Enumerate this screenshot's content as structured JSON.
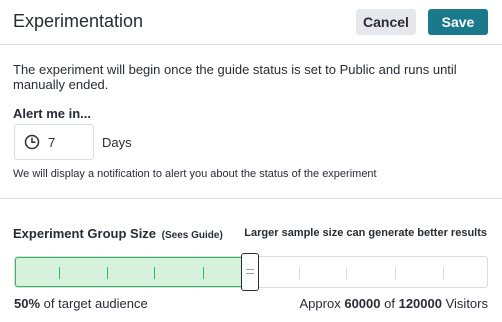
{
  "header": {
    "title": "Experimentation",
    "cancel_label": "Cancel",
    "save_label": "Save"
  },
  "intro_text": "The experiment will begin once the guide status is set to Public and runs until manually ended.",
  "alert": {
    "label": "Alert me in...",
    "value": "7",
    "unit": "Days",
    "notice": "We will display a notification to alert you about the status of the experiment"
  },
  "group_size": {
    "label": "Experiment Group Size",
    "sublabel": "(Sees Guide)",
    "hint": "Larger sample size can generate better results",
    "percent_label": "50%",
    "audience_text": "of target audience",
    "approx_prefix": "Approx",
    "approx_count": "60000",
    "of_text": "of",
    "total_count": "120000",
    "visitors_text": "Visitors",
    "fraction": 0.5
  },
  "colors": {
    "primary": "#1a7a8c",
    "fill": "#d6f2dd",
    "fill_border": "#32b856"
  }
}
